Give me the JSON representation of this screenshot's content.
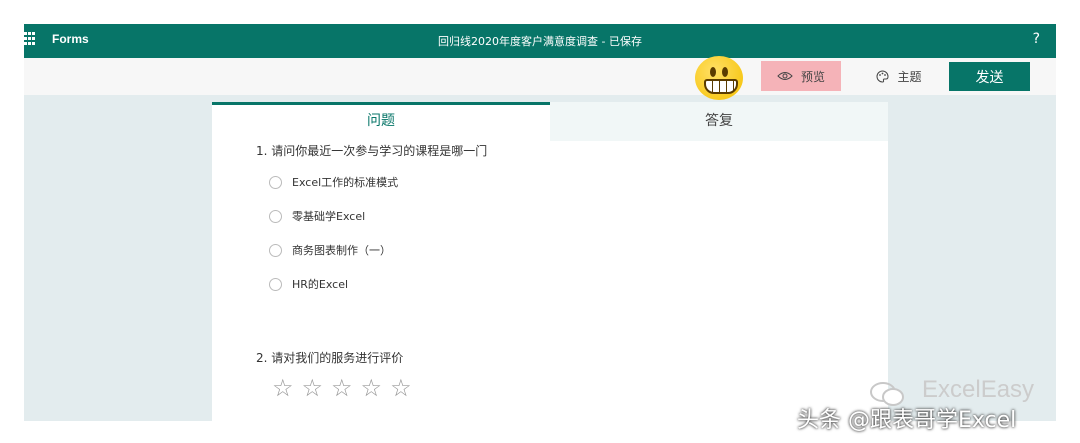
{
  "header": {
    "app_name": "Forms",
    "form_title": "回归线2020年度客户满意度调查 - 已保存",
    "help_label": "?"
  },
  "toolbar": {
    "preview_label": "预览",
    "theme_label": "主题",
    "send_label": "发送"
  },
  "tabs": {
    "questions": "问题",
    "responses": "答复"
  },
  "questions": [
    {
      "title": "1. 请问你最近一次参与学习的课程是哪一门",
      "options": [
        "Excel工作的标准模式",
        "零基础学Excel",
        "商务图表制作（一）",
        "HR的Excel"
      ]
    },
    {
      "title": "2. 请对我们的服务进行评价",
      "rating_max": 5
    }
  ],
  "watermark": {
    "brand": "ExcelEasy",
    "source": "头条 @跟表哥学Excel"
  },
  "colors": {
    "brand": "#077568",
    "preview_bg": "#f5b3b8",
    "content_bg": "#e3ecee"
  }
}
